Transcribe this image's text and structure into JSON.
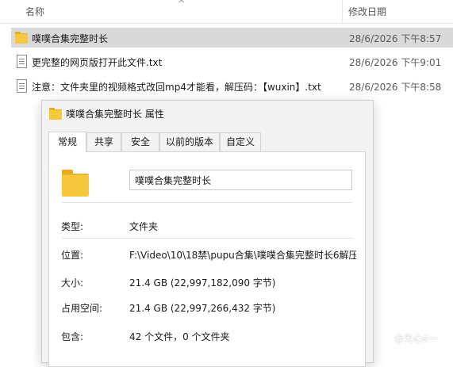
{
  "list": {
    "col_name": "名称",
    "col_date": "修改日期",
    "rows": [
      {
        "name": "噗噗合集完整时长",
        "date": "28/6/2026 下午8:57",
        "icon": "folder-icon"
      },
      {
        "name": "更完整的网页版打开此文件.txt",
        "date": "28/6/2026 下午9:01",
        "icon": "text-file-icon"
      },
      {
        "name": "注意：文件夹里的视频格式改回mp4才能看，解压码：【wuxin】.txt",
        "date": "28/6/2026 下午8:58",
        "icon": "text-file-icon"
      }
    ]
  },
  "dialog": {
    "title": "噗噗合集完整时长 属性",
    "tabs": [
      "常规",
      "共享",
      "安全",
      "以前的版本",
      "自定义"
    ],
    "name_value": "噗噗合集完整时长",
    "props": [
      {
        "label": "类型:",
        "value": "文件夹"
      },
      {
        "label": "位置:",
        "value": "F:\\Video\\10\\18禁\\pupu合集\\噗噗合集完整时长6解压"
      },
      {
        "label": "大小:",
        "value": "21.4 GB (22,997,182,090 字节)"
      },
      {
        "label": "占用空间:",
        "value": "21.4 GB (22,997,266,432 字节)"
      },
      {
        "label": "包含:",
        "value": "42 个文件，0 个文件夹"
      }
    ]
  },
  "watermark": "@无心s一",
  "colors": {
    "selection": "#d9d9d9",
    "folder": "#f8c83c",
    "dialog_bg": "#f3f3f3"
  }
}
